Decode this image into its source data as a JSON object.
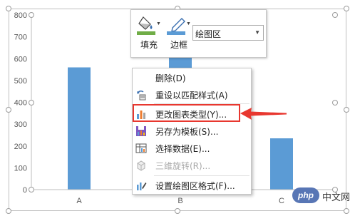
{
  "chart_data": {
    "type": "bar",
    "categories": [
      "A",
      "B",
      "C"
    ],
    "series": [
      {
        "values": [
          560,
          640,
          235
        ]
      }
    ],
    "ylim": [
      0,
      800
    ],
    "yticks": [
      0,
      100,
      200,
      300,
      400,
      500,
      600,
      700,
      800
    ],
    "grid": false,
    "bar_color": "#5b9bd5"
  },
  "mini_toolbar": {
    "fill_label": "填充",
    "border_label": "边框",
    "area_select": "绘图区"
  },
  "context_menu": {
    "items": [
      {
        "label": "删除(D)",
        "icon": "none",
        "enabled": true
      },
      {
        "label": "重设以匹配样式(A)",
        "icon": "reset-style-icon",
        "enabled": true
      },
      {
        "label": "更改图表类型(Y)...",
        "icon": "chart-type-icon",
        "enabled": true,
        "highlighted": true
      },
      {
        "label": "另存为模板(S)...",
        "icon": "save-template-icon",
        "enabled": true
      },
      {
        "label": "选择数据(E)...",
        "icon": "select-data-icon",
        "enabled": true
      },
      {
        "label": "三维旋转(R)...",
        "icon": "3d-rotation-icon",
        "enabled": false
      },
      {
        "label": "设置绘图区格式(F)...",
        "icon": "format-plot-area-icon",
        "enabled": true
      }
    ]
  },
  "annotation": {
    "color": "#e8372f"
  },
  "watermark": {
    "badge": "php",
    "text": "中文网"
  }
}
